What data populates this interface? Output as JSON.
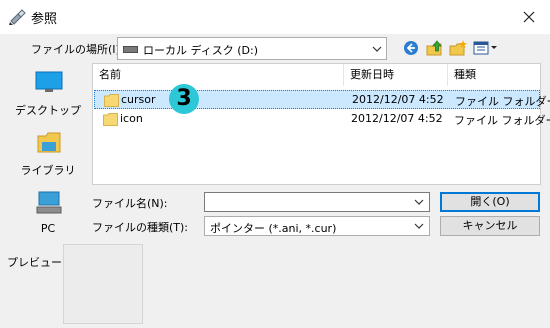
{
  "window": {
    "title": "参照",
    "close_icon": "close-icon"
  },
  "location": {
    "label": "ファイルの場所(I):",
    "value": "ローカル ディスク (D:)"
  },
  "toolbar": {
    "icons": [
      "back-icon",
      "up-folder-icon",
      "new-folder-icon",
      "view-menu-icon"
    ],
    "back_color": "#2b7cd3"
  },
  "places": [
    {
      "label": "デスクトップ",
      "icon": "desktop-icon"
    },
    {
      "label": "ライブラリ",
      "icon": "library-icon"
    },
    {
      "label": "PC",
      "icon": "pc-icon"
    }
  ],
  "file_list": {
    "columns": [
      "名前",
      "更新日時",
      "種類"
    ],
    "rows": [
      {
        "name": "cursor",
        "modified": "2012/12/07 4:52",
        "type": "ファイル フォルダー",
        "selected": true
      },
      {
        "name": "icon",
        "modified": "2012/12/07 4:52",
        "type": "ファイル フォルダー",
        "selected": false
      }
    ],
    "badge": "3",
    "selection_color": "#cce8ff",
    "folder_color": "#f8d775"
  },
  "filename": {
    "label": "ファイル名(N):",
    "value": ""
  },
  "filetype": {
    "label": "ファイルの種類(T):",
    "value": "ポインター (*.ani, *.cur)"
  },
  "buttons": {
    "open": "開く(O)",
    "cancel": "キャンセル"
  },
  "preview": {
    "label": "プレビュー:"
  }
}
